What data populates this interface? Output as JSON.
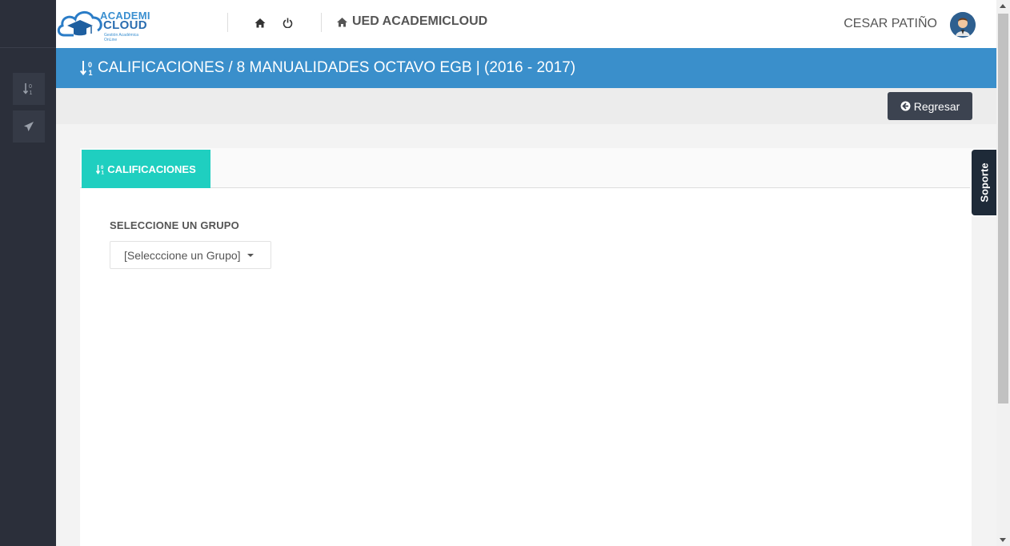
{
  "app": {
    "logo_line1": "ACADEMI",
    "logo_line2": "CLOUD",
    "logo_sub": "Gestión Académica OnLine",
    "school_name": "UED ACADEMICLOUD",
    "user_name": "CESAR PATIÑO"
  },
  "header": {
    "icons": [
      "home-icon",
      "power-icon"
    ]
  },
  "sidebar": {
    "items": [
      {
        "icon": "sort-numeric-icon"
      },
      {
        "icon": "paper-plane-icon"
      }
    ]
  },
  "titlebar": {
    "section": "CALIFICACIONES",
    "separator": "/",
    "course": "8 MANUALIDADES OCTAVO EGB | (2016 - 2017)"
  },
  "toolbar": {
    "back_label": "Regresar"
  },
  "tabs": [
    {
      "label": "CALIFICACIONES",
      "active": true
    }
  ],
  "form": {
    "group_label": "SELECCIONE UN GRUPO",
    "group_select_value": "[Selecccione un Grupo]"
  },
  "support_tab": {
    "label": "Soporte"
  },
  "colors": {
    "sidebar_bg": "#2b2f3a",
    "titlebar_bg": "#3a8fcb",
    "tab_active_bg": "#1fcfc0",
    "button_dark": "#3c4350",
    "support_bg": "#1e2a38"
  }
}
